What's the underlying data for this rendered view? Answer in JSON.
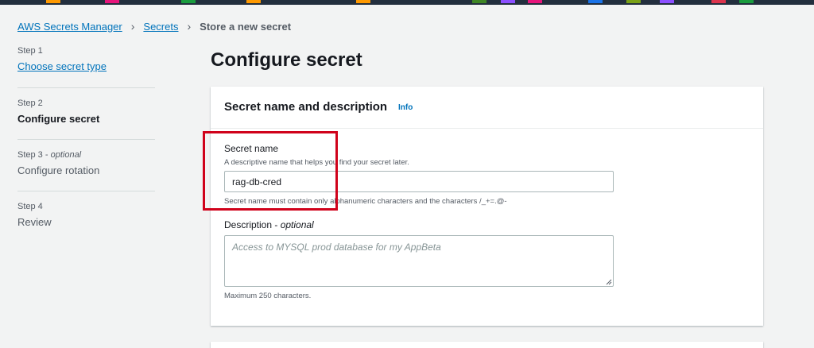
{
  "breadcrumb": {
    "items": [
      "AWS Secrets Manager",
      "Secrets"
    ],
    "current": "Store a new secret"
  },
  "steps": [
    {
      "number": "Step 1",
      "title": "Choose secret type"
    },
    {
      "number": "Step 2",
      "title": "Configure secret"
    },
    {
      "number": "Step 3",
      "optional": "optional",
      "title": "Configure rotation"
    },
    {
      "number": "Step 4",
      "title": "Review"
    }
  ],
  "step_separator": " - ",
  "page": {
    "title": "Configure secret"
  },
  "section": {
    "title": "Secret name and description",
    "info": "Info"
  },
  "secret_name": {
    "label": "Secret name",
    "hint": "A descriptive name that helps you find your secret later.",
    "value": "rag-db-cred",
    "constraint": "Secret name must contain only alphanumeric characters and the characters /_+=.@-"
  },
  "description": {
    "label": "Description - ",
    "optional": "optional",
    "placeholder": "Access to MYSQL prod database for my AppBeta",
    "constraint": "Maximum 250 characters."
  },
  "colors": {
    "link": "#0073bb",
    "highlight": "#d0021b",
    "topbar": "#232f3e"
  }
}
